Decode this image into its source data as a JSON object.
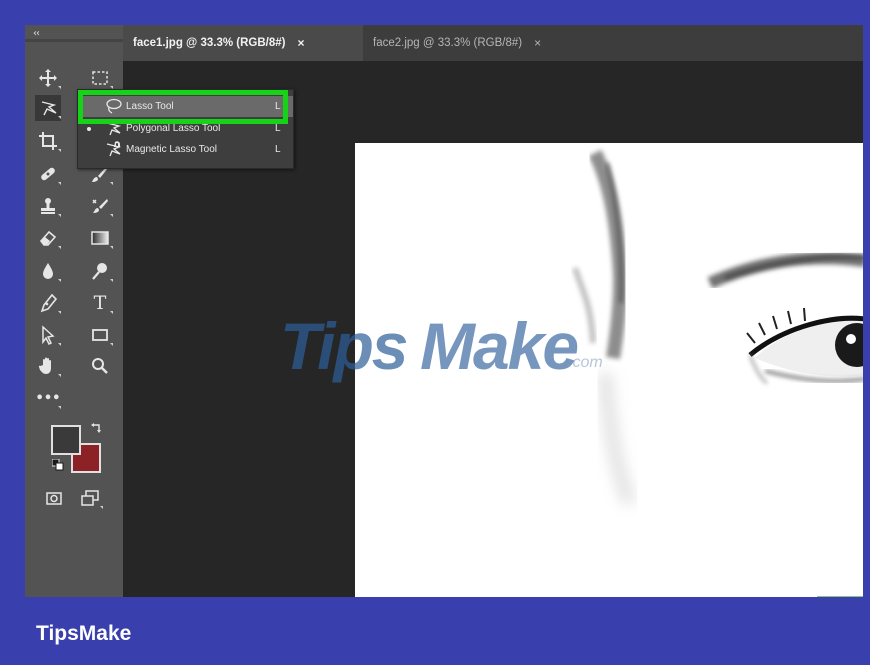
{
  "tabs": [
    {
      "title": "face1.jpg @ 33.3% (RGB/8#)",
      "close": "×"
    },
    {
      "title": "face2.jpg @ 33.3% (RGB/8#)",
      "close": "×"
    }
  ],
  "flyout": {
    "items": [
      {
        "label": "Lasso Tool",
        "shortcut": "L",
        "icon": "lasso-icon"
      },
      {
        "label": "Polygonal Lasso Tool",
        "shortcut": "L",
        "icon": "polygonal-lasso-icon"
      },
      {
        "label": "Magnetic Lasso Tool",
        "shortcut": "L",
        "icon": "magnetic-lasso-icon"
      }
    ]
  },
  "toolbar": {
    "grip": "‹‹",
    "text_tool": "T",
    "edit_toolbar": "•••"
  },
  "colors": {
    "highlight": "#17d317",
    "foreground": "#3a3a3a",
    "background": "#8d2226",
    "page_bg": "#3a3fae"
  },
  "watermark": {
    "brand": "TipsMake",
    "suffix": ".com"
  },
  "footer": {
    "brand": "TipsMake"
  }
}
